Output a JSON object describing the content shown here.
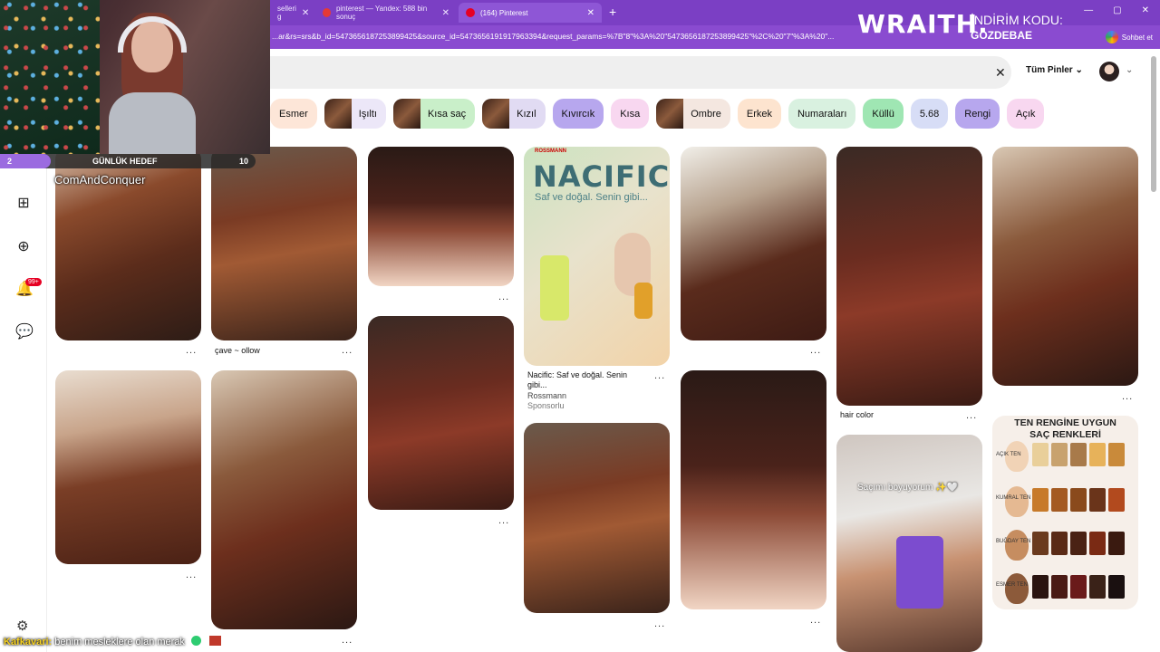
{
  "browser": {
    "tabs": [
      {
        "title": "selleri g"
      },
      {
        "title": "pinterest — Yandex: 588 bin sonuç"
      },
      {
        "title": "(164) Pinterest"
      }
    ],
    "new_tab": "+",
    "url": "...ar&rs=srs&b_id=5473656187253899425&source_id=5473656191917963394&request_params=%7B\"8\"%3A%20\"5473656187253899425\"%2C%20\"7\"%3A%20\"...",
    "chat_label": "Sohbet et",
    "window_controls": [
      "—",
      "▢",
      "✕"
    ]
  },
  "promo": {
    "brand": "WRAITH.",
    "code_label": "İNDİRİM KODU:",
    "code_value": "GOZDEBAE"
  },
  "search": {
    "clear": "✕",
    "filter_label": "Tüm Pinler",
    "chevron": "⌄"
  },
  "chips": [
    {
      "label": "Esmer",
      "color": "#fde6d8",
      "thumb": false
    },
    {
      "label": "Işıltı",
      "color": "#ece7f8",
      "thumb": true
    },
    {
      "label": "Kısa saç",
      "color": "#c9efc9",
      "thumb": true
    },
    {
      "label": "Kızıl",
      "color": "#e1dbf3",
      "thumb": true
    },
    {
      "label": "Kıvırcık",
      "color": "#b7a7ee",
      "thumb": false
    },
    {
      "label": "Kısa",
      "color": "#f8d7f0",
      "thumb": false
    },
    {
      "label": "Ombre",
      "color": "#f4e7e0",
      "thumb": true
    },
    {
      "label": "Erkek",
      "color": "#fde4cf",
      "thumb": false
    },
    {
      "label": "Numaraları",
      "color": "#d9f1e0",
      "thumb": false
    },
    {
      "label": "Küllü",
      "color": "#9fe6b3",
      "thumb": false
    },
    {
      "label": "5.68",
      "color": "#d7ddf6",
      "thumb": false
    },
    {
      "label": "Rengi",
      "color": "#b7a7ee",
      "thumb": false
    },
    {
      "label": "Açık",
      "color": "#f8d7f0",
      "thumb": false
    }
  ],
  "rail": {
    "badge": "99+"
  },
  "stream": {
    "goal_left": "2",
    "goal_label": "GÜNLÜK HEDEF",
    "goal_right": "10",
    "goal_progress": 0.2,
    "tag": "ComAndConquer",
    "chat_user": "Kafkavari:",
    "chat_msg": "benim mesleklere olan merak"
  },
  "pins": {
    "p2_caption": "çave ~ ollow",
    "ad": {
      "store": "ROSSMANN",
      "title": "NACIFIC",
      "tag": "Saf ve doğal. Senin gibi...",
      "caption_1": "Nacific: Saf ve doğal. Senin",
      "caption_2": "gibi...",
      "advertiser": "Rossmann",
      "sponsored": "Sponsorlu"
    },
    "hair_color_caption": "hair color",
    "chart": {
      "title_1": "TEN RENGİNE UYGUN",
      "title_2": "SAÇ RENKLERİ",
      "tones": [
        "AÇIK TEN",
        "KUMRAL TEN",
        "BUĞDAY TEN",
        "ESMER TEN"
      ]
    },
    "video_text": "Saçımı boyuyorum ✨🤍",
    "dots": "..."
  }
}
